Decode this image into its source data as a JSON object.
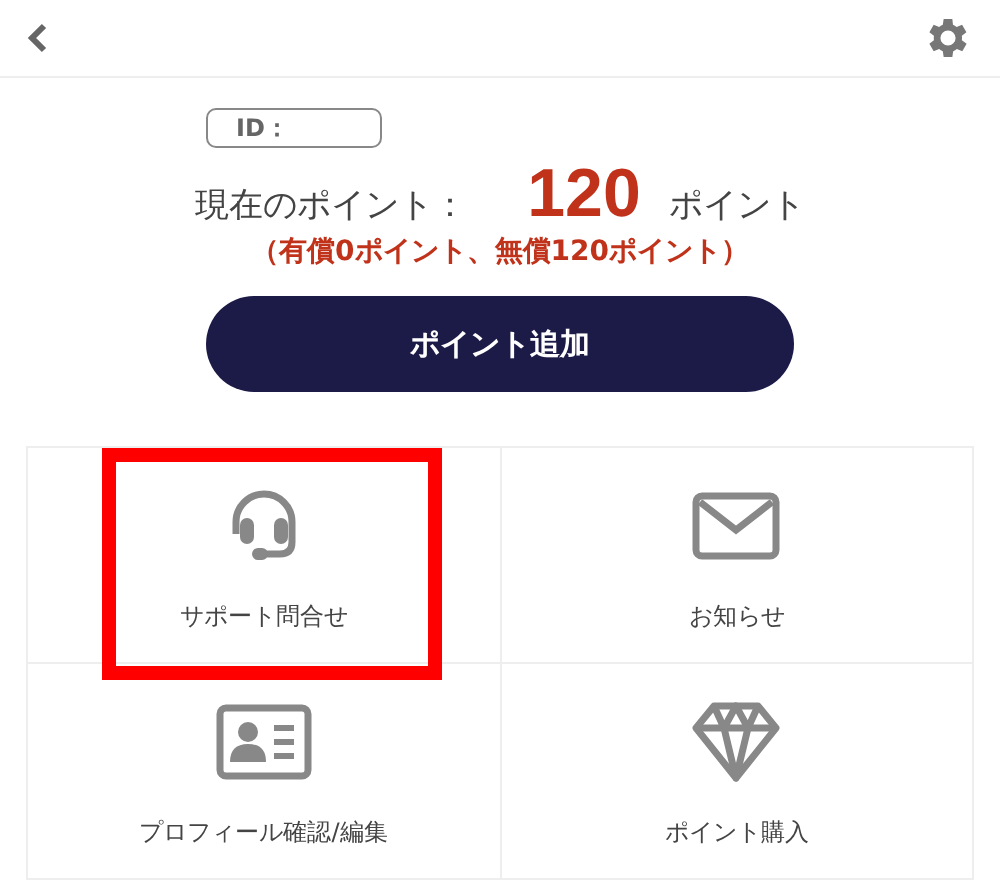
{
  "id_label": "ID：",
  "points": {
    "label": "現在のポイント：",
    "value": "120",
    "unit": "ポイント",
    "breakdown": "（有償0ポイント、無償120ポイント）"
  },
  "add_button": "ポイント追加",
  "menu": [
    {
      "kind": "support",
      "label": "サポート問合せ",
      "highlighted": true
    },
    {
      "kind": "news",
      "label": "お知らせ",
      "highlighted": false
    },
    {
      "kind": "profile",
      "label": "プロフィール確認/編集",
      "highlighted": false
    },
    {
      "kind": "purchase",
      "label": "ポイント購入",
      "highlighted": false
    }
  ]
}
